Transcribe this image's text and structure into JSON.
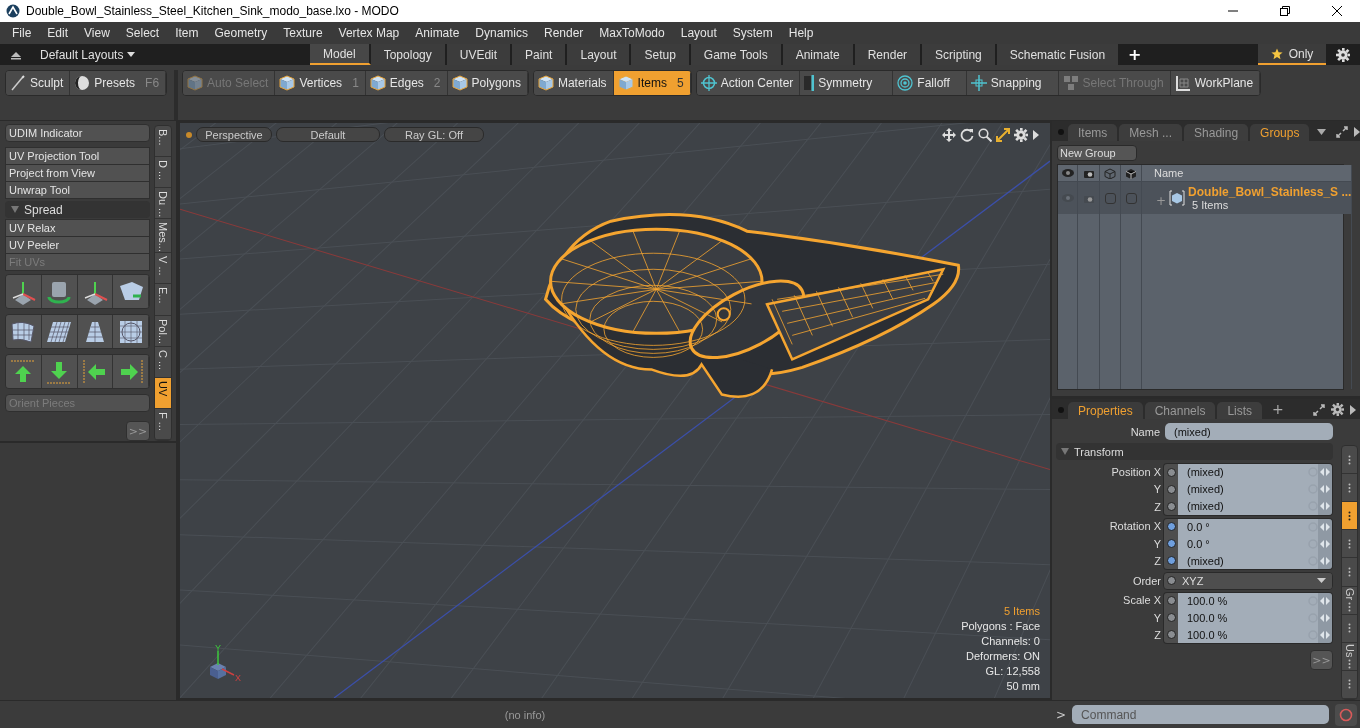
{
  "window": {
    "title": "Double_Bowl_Stainless_Steel_Kitchen_Sink_modo_base.lxo - MODO"
  },
  "menu_bar": [
    "File",
    "Edit",
    "View",
    "Select",
    "Item",
    "Geometry",
    "Texture",
    "Vertex Map",
    "Animate",
    "Dynamics",
    "Render",
    "MaxToModo",
    "Layout",
    "System",
    "Help"
  ],
  "layout_bar": {
    "layouts_menu": "Default Layouts",
    "tabs": [
      {
        "label": "Model",
        "selected": true
      },
      {
        "label": "Topology",
        "selected": false
      },
      {
        "label": "UVEdit",
        "selected": false
      },
      {
        "label": "Paint",
        "selected": false
      },
      {
        "label": "Layout",
        "selected": false
      },
      {
        "label": "Setup",
        "selected": false
      },
      {
        "label": "Game Tools",
        "selected": false
      },
      {
        "label": "Animate",
        "selected": false
      },
      {
        "label": "Render",
        "selected": false
      },
      {
        "label": "Scripting",
        "selected": false
      },
      {
        "label": "Schematic Fusion",
        "selected": false
      }
    ],
    "add_tab": "+",
    "filter": {
      "label": "Only",
      "on": true
    }
  },
  "toolbar": {
    "groups": [
      {
        "buttons": [
          {
            "kind": "brush",
            "label": "Sculpt",
            "selected": false,
            "disabled": false
          },
          {
            "kind": "sphere",
            "label": "Presets",
            "shortcut": "F6",
            "selected": false,
            "disabled": false
          }
        ]
      },
      {
        "buttons": [
          {
            "kind": "cube",
            "label": "Auto Select",
            "selected": false,
            "disabled": true
          },
          {
            "kind": "cube",
            "label": "Vertices",
            "shortcut": "1",
            "selected": false,
            "disabled": false
          },
          {
            "kind": "cube",
            "label": "Edges",
            "shortcut": "2",
            "selected": false,
            "disabled": false
          },
          {
            "kind": "cube",
            "label": "Polygons",
            "selected": false,
            "disabled": false
          }
        ]
      },
      {
        "buttons": [
          {
            "kind": "cube",
            "label": "Materials",
            "selected": false,
            "disabled": false
          },
          {
            "kind": "cube",
            "label": "Items",
            "shortcut": "5",
            "selected": true,
            "disabled": false
          }
        ]
      },
      {
        "buttons": [
          {
            "kind": "target",
            "label": "Action Center",
            "selected": false,
            "disabled": false
          },
          {
            "kind": "symmetry",
            "label": "Symmetry",
            "selected": false,
            "disabled": false
          },
          {
            "kind": "falloff",
            "label": "Falloff",
            "selected": false,
            "disabled": false
          },
          {
            "kind": "snapping",
            "label": "Snapping",
            "selected": false,
            "disabled": false
          },
          {
            "kind": "cubes",
            "label": "Select Through",
            "selected": false,
            "disabled": true
          },
          {
            "kind": "workplane",
            "label": "WorkPlane",
            "selected": false,
            "disabled": false
          }
        ]
      }
    ]
  },
  "left_panel": {
    "items": [
      {
        "kind": "button",
        "label": "UDIM Indicator",
        "disabled": false
      },
      {
        "kind": "gap"
      },
      {
        "kind": "button",
        "label": "UV Projection Tool",
        "disabled": false
      },
      {
        "kind": "button",
        "label": "Project from View",
        "disabled": false
      },
      {
        "kind": "button",
        "label": "Unwrap Tool",
        "disabled": false
      },
      {
        "kind": "section",
        "label": "Spread",
        "expanded": true
      },
      {
        "kind": "button",
        "label": "UV Relax",
        "disabled": false
      },
      {
        "kind": "button",
        "label": "UV Peeler",
        "disabled": false
      },
      {
        "kind": "button",
        "label": "Fit UVs",
        "disabled": true
      },
      {
        "kind": "icons"
      },
      {
        "kind": "icons"
      },
      {
        "kind": "icons"
      },
      {
        "kind": "button",
        "label": "Orient Pieces",
        "disabled": true
      }
    ],
    "more": ">>",
    "side_tabs": [
      {
        "label": "B...",
        "selected": false
      },
      {
        "label": "D ...",
        "selected": false
      },
      {
        "label": "Du ...",
        "selected": false
      },
      {
        "label": "Mes...",
        "selected": false
      },
      {
        "label": "V ...",
        "selected": false
      },
      {
        "label": "E...",
        "selected": false
      },
      {
        "label": "Pol...",
        "selected": false
      },
      {
        "label": "C ...",
        "selected": false
      },
      {
        "label": "UV",
        "selected": true
      },
      {
        "label": "F ...",
        "selected": false
      }
    ]
  },
  "viewport": {
    "buttons": [
      "Perspective",
      "Default",
      "Ray GL: Off"
    ],
    "info": [
      {
        "text": "5 Items",
        "highlight": true
      },
      {
        "text": "Polygons : Face",
        "highlight": false
      },
      {
        "text": "Channels: 0",
        "highlight": false
      },
      {
        "text": "Deformers: ON",
        "highlight": false
      },
      {
        "text": "GL: 12,558",
        "highlight": false
      },
      {
        "text": "50 mm",
        "highlight": false
      }
    ],
    "gizmo_labels": [
      "Y",
      "X"
    ]
  },
  "groups_panel": {
    "tabs": [
      {
        "label": "Items",
        "selected": false
      },
      {
        "label": "Mesh ...",
        "selected": false
      },
      {
        "label": "Shading",
        "selected": false
      },
      {
        "label": "Groups",
        "selected": true
      }
    ],
    "new_group": "New Group",
    "name_column": "Name",
    "rows": [
      {
        "name": "Double_Bowl_Stainless_S ...",
        "count": "5 Items",
        "expand": "+",
        "checks": [
          false,
          false
        ]
      }
    ]
  },
  "properties": {
    "tabs": [
      {
        "label": "Properties",
        "selected": true
      },
      {
        "label": "Channels",
        "selected": false
      },
      {
        "label": "Lists",
        "selected": false
      }
    ],
    "add_tab": "+",
    "name_label": "Name",
    "name_value": "(mixed)",
    "section": {
      "label": "Transform",
      "expanded": true
    },
    "groups": [
      {
        "rows": [
          {
            "kind": "field",
            "label": "Position X",
            "value": "(mixed)",
            "color": "#8a8d91"
          },
          {
            "kind": "field",
            "label": "Y",
            "value": "(mixed)",
            "color": "#8a8d91"
          },
          {
            "kind": "field",
            "label": "Z",
            "value": "(mixed)",
            "color": "#8a8d91"
          }
        ]
      },
      {
        "rows": [
          {
            "kind": "field",
            "label": "Rotation X",
            "value": "0.0 °",
            "color": "#6f9fde"
          },
          {
            "kind": "field",
            "label": "Y",
            "value": "0.0 °",
            "color": "#6f9fde"
          },
          {
            "kind": "field",
            "label": "Z",
            "value": "(mixed)",
            "color": "#6f9fde"
          },
          {
            "kind": "dropdown",
            "label": "Order",
            "value": "XYZ",
            "color": "#8a8d91"
          }
        ]
      },
      {
        "rows": [
          {
            "kind": "field",
            "label": "Scale X",
            "value": "100.0 %",
            "color": "#8a8d91"
          },
          {
            "kind": "field",
            "label": "Y",
            "value": "100.0 %",
            "color": "#8a8d91"
          },
          {
            "kind": "field",
            "label": "Z",
            "value": "100.0 %",
            "color": "#8a8d91"
          }
        ]
      }
    ],
    "more": ">>",
    "side_tabs": [
      {
        "selected": false
      },
      {
        "selected": false
      },
      {
        "selected": true
      },
      {
        "selected": false
      },
      {
        "selected": false
      },
      {
        "label": "Gr",
        "selected": false
      },
      {
        "selected": false
      },
      {
        "label": "Us",
        "selected": false
      },
      {
        "selected": false
      }
    ]
  },
  "status_bar": {
    "info": "(no info)",
    "prompt": ">",
    "command_placeholder": "Command"
  }
}
